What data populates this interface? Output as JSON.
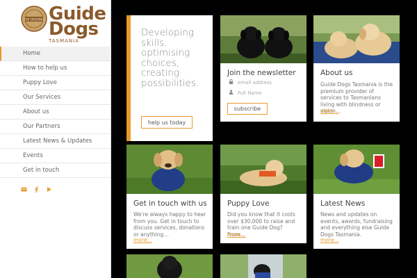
{
  "brand": {
    "seal_text": "THE ORIGINAL",
    "name_line1": "Guide",
    "name_line2": "Dogs",
    "region": "TASMANIA",
    "brand_color": "#8b5a2b",
    "accent_color": "#e89a2c"
  },
  "sidebar": {
    "items": [
      {
        "label": "Home",
        "active": true
      },
      {
        "label": "How to help us"
      },
      {
        "label": "Puppy Love"
      },
      {
        "label": "Our Services"
      },
      {
        "label": "About us"
      },
      {
        "label": "Our Partners"
      },
      {
        "label": "Latest News & Updates"
      },
      {
        "label": "Events"
      },
      {
        "label": "Get in touch"
      }
    ],
    "social_icons": [
      "email-icon",
      "facebook-icon",
      "youtube-icon"
    ]
  },
  "hero": {
    "text": "Developing skills, optimising choices, creating possibilities.",
    "button": "help us today"
  },
  "newsletter": {
    "title": "Join the newsletter",
    "email_placeholder": "email address",
    "name_placeholder": "Full Name",
    "button": "subscribe"
  },
  "about": {
    "title": "About us",
    "body": "Guide Dogs Tasmania is the premium provider of services to Tasmanians living with blindness or vision…",
    "more": "more..."
  },
  "contact": {
    "title": "Get in touch with us",
    "body": "We're always happy to hear from you. Get in touch to discuss services, donations or anything…",
    "more": "more..."
  },
  "puppy": {
    "title": "Puppy Love",
    "body": "Did you know that it costs over $30,000 to raise and train one Guide Dog? From…",
    "more": "more..."
  },
  "news": {
    "title": "Latest News",
    "body": "News and updates on events, awards, fundraising and everything else Guide Dogs Tasmania.",
    "more": "more..."
  }
}
